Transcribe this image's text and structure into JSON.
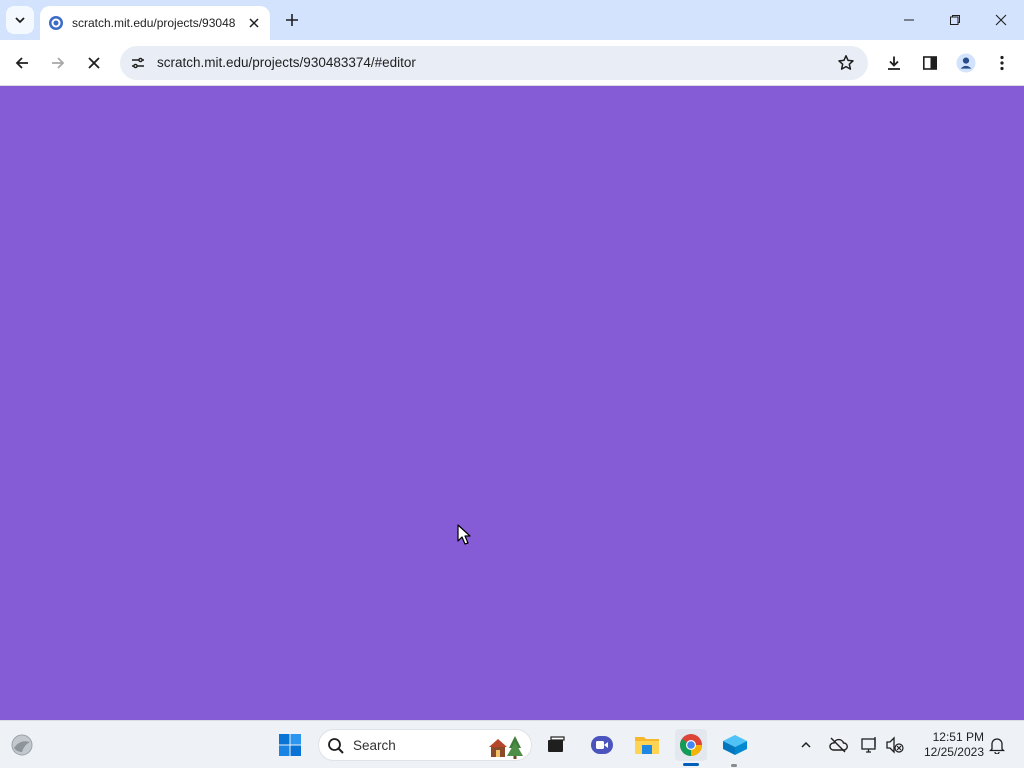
{
  "browser": {
    "tab": {
      "title": "scratch.mit.edu/projects/93048",
      "favicon": "scratch-favicon-icon"
    },
    "window_controls": [
      "minimize-icon",
      "restore-icon",
      "close-icon"
    ],
    "toolbar": {
      "back": "back-arrow-icon",
      "forward": "forward-arrow-icon",
      "stop": "stop-loading-icon",
      "url": "scratch.mit.edu/projects/930483374/#editor",
      "right_icons": [
        "download-icon",
        "side-panel-icon",
        "profile-icon",
        "menu-icon"
      ]
    }
  },
  "page": {
    "background_color": "#855cd6",
    "state": "loading"
  },
  "taskbar": {
    "search_label": "Search",
    "pinned": [
      "widgets-icon",
      "start-icon",
      "task-view-icon",
      "meet-icon",
      "file-explorer-icon",
      "chrome-icon",
      "app-icon"
    ],
    "tray": [
      "show-hidden-icons-icon",
      "onedrive-icon",
      "network-icon",
      "volume-muted-icon",
      "notifications-icon"
    ],
    "time": "12:51 PM",
    "date": "12/25/2023"
  },
  "colors": {
    "tabstrip": "#d3e3fd",
    "accent": "#005fb8",
    "page": "#855cd6"
  }
}
